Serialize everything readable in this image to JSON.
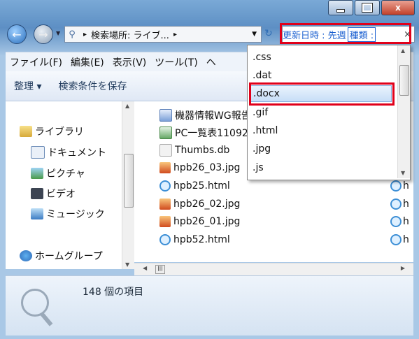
{
  "window": {
    "caption_min": "—",
    "caption_max": "□",
    "caption_close": "x"
  },
  "address": {
    "text": "検索場所: ライブ...",
    "sep": "▸"
  },
  "search": {
    "text": "更新日時 : 先週",
    "kind_label": "種類 :",
    "clear": "×"
  },
  "menu": [
    "ファイル(F)",
    "編集(E)",
    "表示(V)",
    "ツール(T)",
    "ヘ"
  ],
  "toolbar": {
    "organize": "整理 ▾",
    "save_search": "検索条件を保存"
  },
  "sidebar": [
    {
      "label": "ライブラリ",
      "icon": "library-icon"
    },
    {
      "label": "ドキュメント",
      "icon": "documents-icon"
    },
    {
      "label": "ピクチャ",
      "icon": "pictures-icon"
    },
    {
      "label": "ビデオ",
      "icon": "video-icon"
    },
    {
      "label": "ミュージック",
      "icon": "music-icon"
    },
    {
      "label": "ホームグループ",
      "icon": "homegroup-icon"
    }
  ],
  "files": [
    {
      "name": "機器情報WG報告",
      "type": "word"
    },
    {
      "name": "PC一覧表11092",
      "type": "excel"
    },
    {
      "name": "Thumbs.db",
      "type": "thumb"
    },
    {
      "name": "hpb26_03.jpg",
      "type": "jpg"
    },
    {
      "name": "hpb25.html",
      "type": "html"
    },
    {
      "name": "hpb26_02.jpg",
      "type": "jpg"
    },
    {
      "name": "hpb26_01.jpg",
      "type": "jpg"
    },
    {
      "name": "hpb52.html",
      "type": "html"
    }
  ],
  "right_column": [
    "h",
    "h",
    "h",
    "h"
  ],
  "status": {
    "count": "148 個の項目"
  },
  "kind_dropdown": {
    "items": [
      ".css",
      ".dat",
      ".docx",
      ".gif",
      ".html",
      ".jpg",
      ".js"
    ],
    "selected": ".docx"
  },
  "colors": {
    "highlight_red": "#e0001a",
    "search_text_blue": "#1a5fd0"
  }
}
